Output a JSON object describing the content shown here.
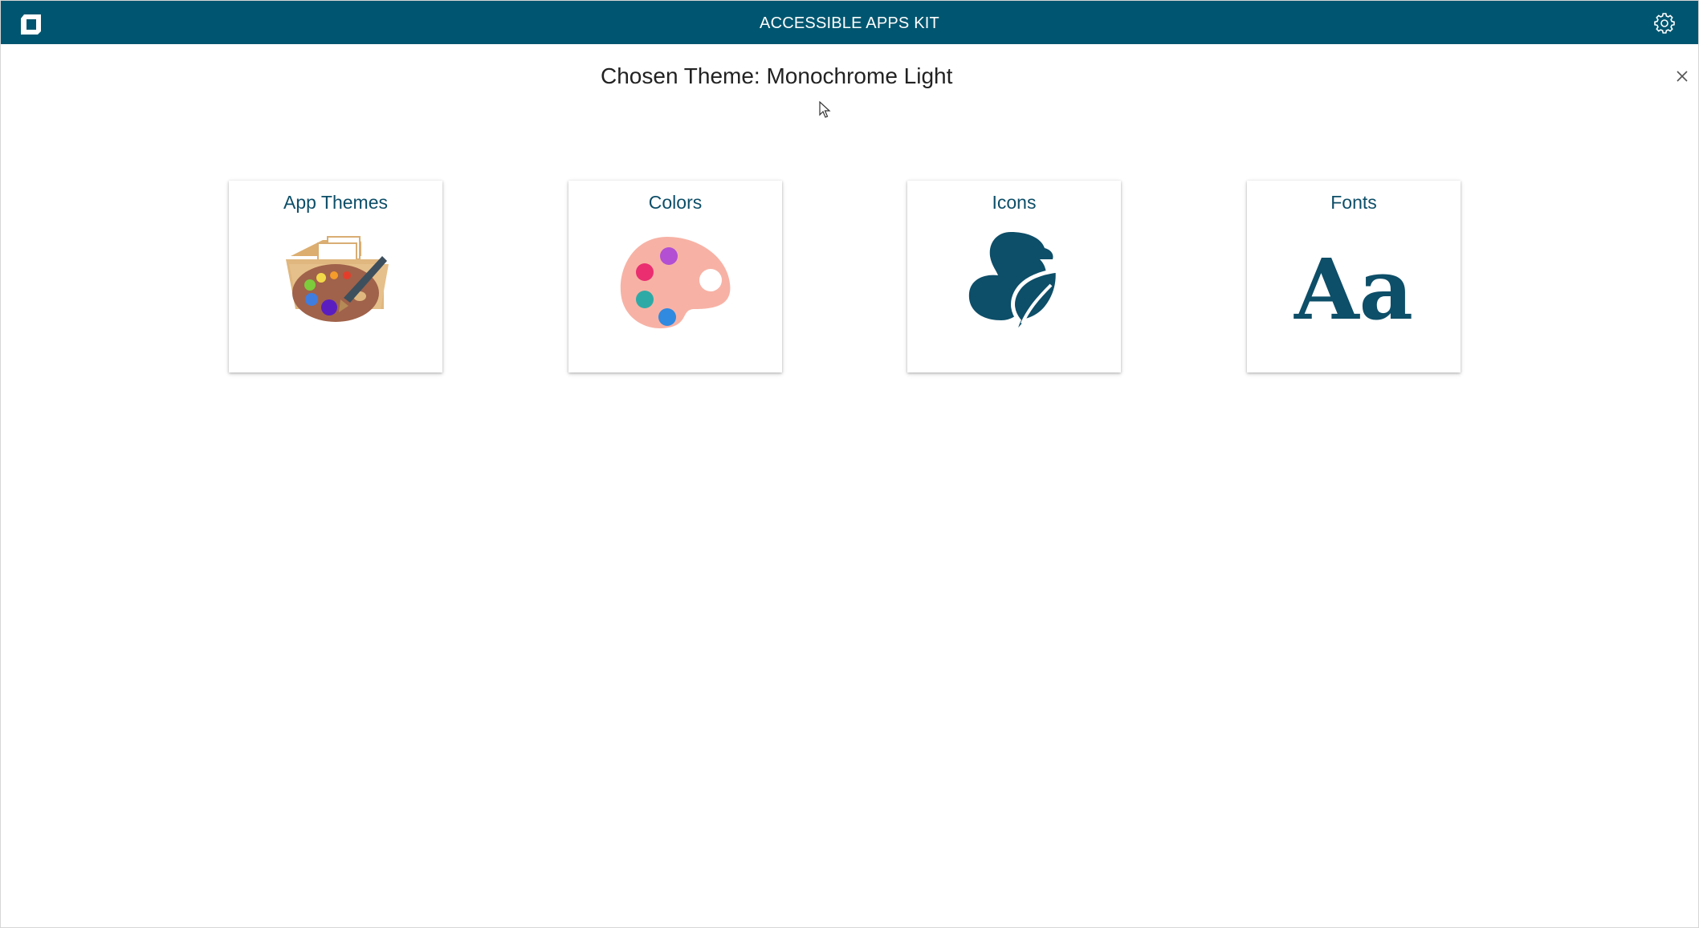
{
  "app": {
    "title": "ACCESSIBLE APPS KIT",
    "logo_icon": "app-logo-icon",
    "settings_icon": "gear-icon",
    "header_color": "#005670"
  },
  "page": {
    "title": "Chosen Theme: Monochrome Light",
    "close_icon": "close-icon"
  },
  "tiles": [
    {
      "label": "App Themes",
      "icon": "folder-palette-icon"
    },
    {
      "label": "Colors",
      "icon": "color-palette-icon"
    },
    {
      "label": "Icons",
      "icon": "duck-leaf-icon"
    },
    {
      "label": "Fonts",
      "icon": "font-sample-icon",
      "icon_text": "Aa"
    }
  ],
  "colors": {
    "accent": "#0d4e68",
    "title_text": "#222222"
  }
}
